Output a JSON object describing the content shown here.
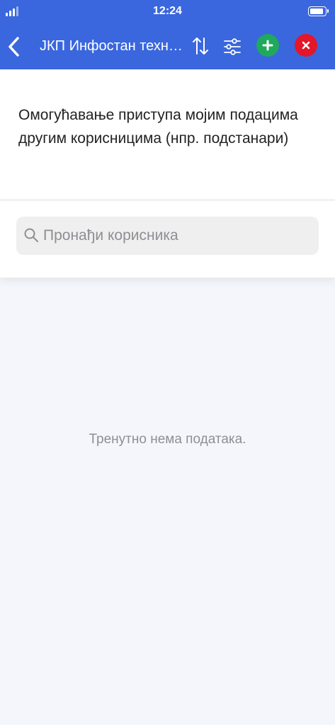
{
  "status_bar": {
    "time": "12:24",
    "battery_level": 0.9
  },
  "nav": {
    "title": "ЈКП Инфостан техно…",
    "back_icon": "chevron-left-icon",
    "sort_icon": "sort-arrows-icon",
    "filter_icon": "sliders-icon",
    "add_icon": "plus-icon",
    "close_icon": "x-icon",
    "colors": {
      "bar": "#3a67dd",
      "add": "#1fa95b",
      "close": "#e3162a"
    }
  },
  "page": {
    "heading": "Омогућавање приступа мојим подацима другим корисницима (нпр. подстанари)",
    "search": {
      "placeholder": "Пронађи корисника",
      "value": ""
    },
    "empty_message": "Тренутно нема података."
  }
}
